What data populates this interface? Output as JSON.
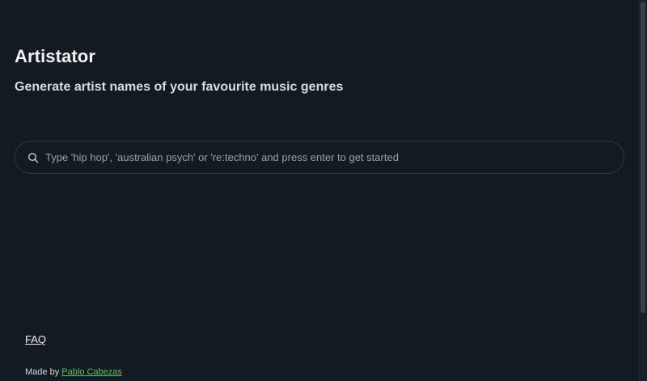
{
  "header": {
    "title": "Artistator",
    "subtitle": "Generate artist names of your favourite music genres"
  },
  "search": {
    "icon": "search-icon",
    "placeholder": "Type 'hip hop', 'australian psych' or 're:techno' and press enter to get started",
    "value": ""
  },
  "footer": {
    "faq_label": "FAQ",
    "made_by_label": "Made by",
    "author_name": "Pablo Cabezas"
  },
  "colors": {
    "background": "#141a21",
    "link_accent": "#5fbf6a"
  }
}
